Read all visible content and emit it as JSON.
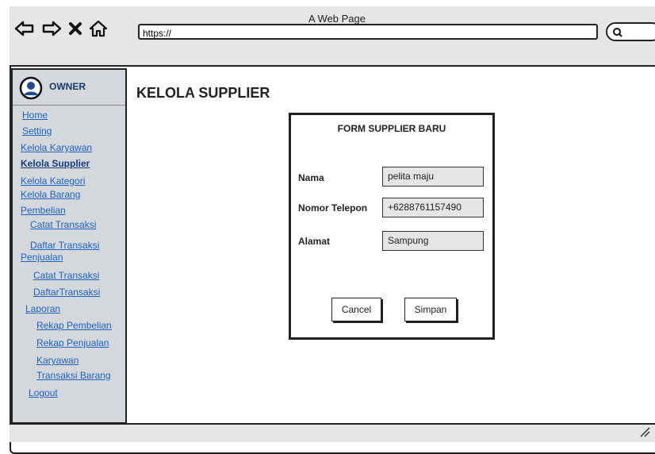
{
  "browser": {
    "title": "A Web Page",
    "url": "https://",
    "icons": [
      "back-icon",
      "forward-icon",
      "stop-icon",
      "home-icon",
      "search-icon"
    ]
  },
  "sidebar": {
    "user": "OWNER",
    "items": [
      {
        "label": "Home",
        "active": false
      },
      {
        "label": "Setting",
        "active": false
      },
      {
        "label": "Kelola Karyawan",
        "active": false
      },
      {
        "label": "Kelola Supplier",
        "active": true
      },
      {
        "label": "Kelola Kategori",
        "active": false
      },
      {
        "label": "Kelola Barang",
        "active": false
      },
      {
        "label": "Pembelian",
        "active": false
      },
      {
        "label": "Catat Transaksi",
        "active": false
      },
      {
        "label": "Daftar Transaksi",
        "active": false
      },
      {
        "label": "Penjualan",
        "active": false
      },
      {
        "label": "Catat Transaksi",
        "active": false
      },
      {
        "label": "DaftarTransaksi",
        "active": false
      },
      {
        "label": "Laporan",
        "active": false
      },
      {
        "label": "Rekap Pembelian",
        "active": false
      },
      {
        "label": "Rekap Penjualan",
        "active": false
      },
      {
        "label": "Karyawan",
        "active": false
      },
      {
        "label": "Transaksi Barang",
        "active": false
      },
      {
        "label": "Logout",
        "active": false
      }
    ]
  },
  "main": {
    "heading": "KELOLA SUPPLIER",
    "form": {
      "title": "FORM SUPPLIER BARU",
      "fields": [
        {
          "label": "Nama",
          "value": "pelita maju"
        },
        {
          "label": "Nomor Telepon",
          "value": "+6288761157490"
        },
        {
          "label": "Alamat",
          "value": "Sampung"
        }
      ],
      "cancel_label": "Cancel",
      "submit_label": "Simpan"
    }
  }
}
